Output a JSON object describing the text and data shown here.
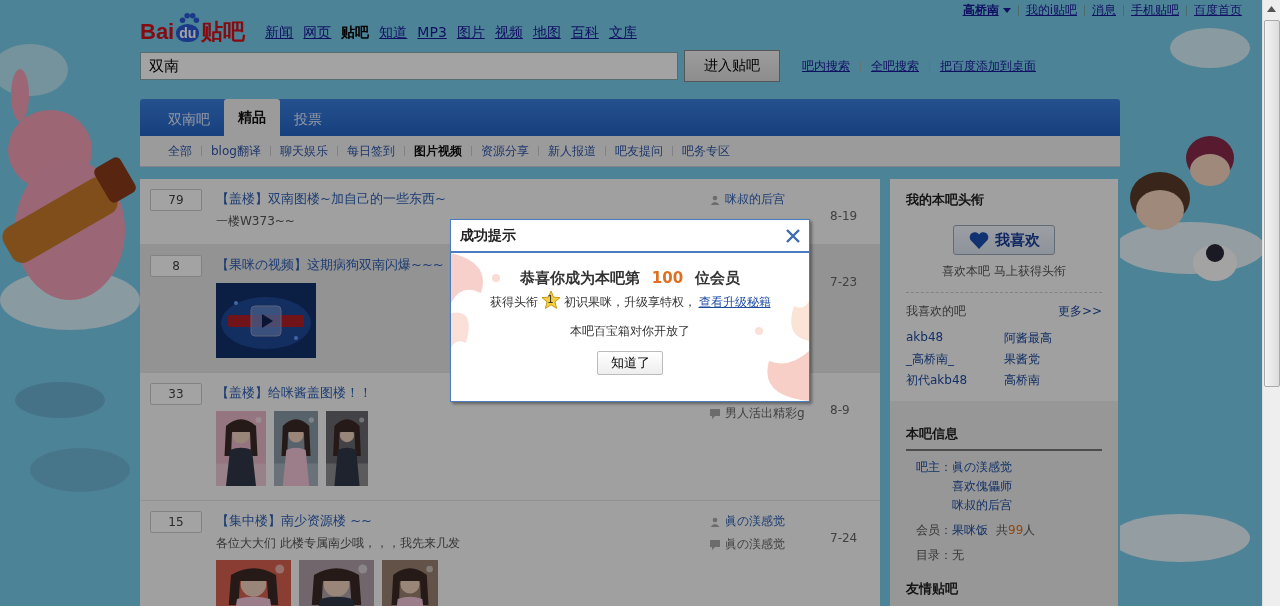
{
  "logo": {
    "prefix": "Bai",
    "badge": "du",
    "suffix": "贴吧"
  },
  "user_nav": [
    {
      "label": "高桥南",
      "kind": "dropdown"
    },
    {
      "label": "我的i贴吧",
      "kind": "link"
    },
    {
      "label": "消息",
      "kind": "link"
    },
    {
      "label": "手机贴吧",
      "kind": "link"
    },
    {
      "label": "百度首页",
      "kind": "link"
    }
  ],
  "nav": [
    {
      "label": "新闻",
      "selected": false
    },
    {
      "label": "网页",
      "selected": false
    },
    {
      "label": "贴吧",
      "selected": true
    },
    {
      "label": "知道",
      "selected": false
    },
    {
      "label": "MP3",
      "selected": false
    },
    {
      "label": "图片",
      "selected": false
    },
    {
      "label": "视频",
      "selected": false
    },
    {
      "label": "地图",
      "selected": false
    },
    {
      "label": "百科",
      "selected": false
    },
    {
      "label": "文库",
      "selected": false
    }
  ],
  "search": {
    "value": "双南",
    "button": "进入贴吧",
    "links": [
      "吧内搜索",
      "全吧搜索",
      "把百度添加到桌面"
    ]
  },
  "tabs": [
    {
      "label": "双南吧",
      "selected": false
    },
    {
      "label": "精品",
      "selected": true
    },
    {
      "label": "投票",
      "selected": false
    }
  ],
  "categories": [
    {
      "label": "全部",
      "selected": false
    },
    {
      "label": "blog翻译",
      "selected": false
    },
    {
      "label": "聊天娱乐",
      "selected": false
    },
    {
      "label": "每日签到",
      "selected": false
    },
    {
      "label": "图片视频",
      "selected": true
    },
    {
      "label": "资源分享",
      "selected": false
    },
    {
      "label": "新人报道",
      "selected": false
    },
    {
      "label": "吧友提问",
      "selected": false
    },
    {
      "label": "吧务专区",
      "selected": false
    }
  ],
  "threads": [
    {
      "replies": "79",
      "title": "【盖楼】双南图楼~加自己的一些东西~",
      "excerpt": "一楼W373~~",
      "author": "咪叔的后宫",
      "date": "8-19",
      "highlighted": false
    },
    {
      "replies": "8",
      "title": "【果咪の视频】这期病狗双南闪爆~~~",
      "date": "7-23",
      "highlighted": true,
      "media": [
        {
          "kind": "video"
        }
      ]
    },
    {
      "replies": "33",
      "title": "【盖楼】给咪酱盖图楼！！",
      "last_reply": "男人活出精彩g",
      "date": "8-9",
      "highlighted": false
    },
    {
      "replies": "15",
      "title": "【集中楼】南少资源楼 ~~",
      "excerpt": "各位大大们 此楼专属南少哦，，，我先来几发",
      "author": "眞の渼感觉",
      "last_reply": "眞の渼感觉",
      "date": "7-24",
      "highlighted": false
    }
  ],
  "sidebar": {
    "title_card": {
      "heading": "我的本吧头衔",
      "like_button": "我喜欢",
      "hint": "喜欢本吧 马上获得头衔",
      "liked_heading": "我喜欢的吧",
      "more": "更多>>",
      "liked_bars": [
        "akb48",
        "阿酱最高",
        "_高桥南_",
        "果酱党",
        "初代akb48",
        "高桥南"
      ]
    },
    "info": {
      "heading": "本吧信息",
      "owner_label": "吧主：",
      "owners": [
        "眞の渼感觉",
        "喜欢傀儡师",
        "咪叔的后宫"
      ],
      "member_label": "会员：",
      "member_name": "果咪饭",
      "member_prefix": "共",
      "member_count": "99",
      "member_suffix": "人",
      "catalog_label": "目录：",
      "catalog_value": "无"
    },
    "friends_heading": "友情贴吧"
  },
  "dialog": {
    "title": "成功提示",
    "headline_prefix": "恭喜你成为本吧第",
    "headline_number": "100",
    "headline_suffix": "位会员",
    "reward_prefix": "获得头衔",
    "badge_level": "1",
    "reward_text": "初识果咪，升级享特权，",
    "reward_link": "查看升级秘籍",
    "message": "本吧百宝箱对你开放了",
    "button": "知道了"
  }
}
